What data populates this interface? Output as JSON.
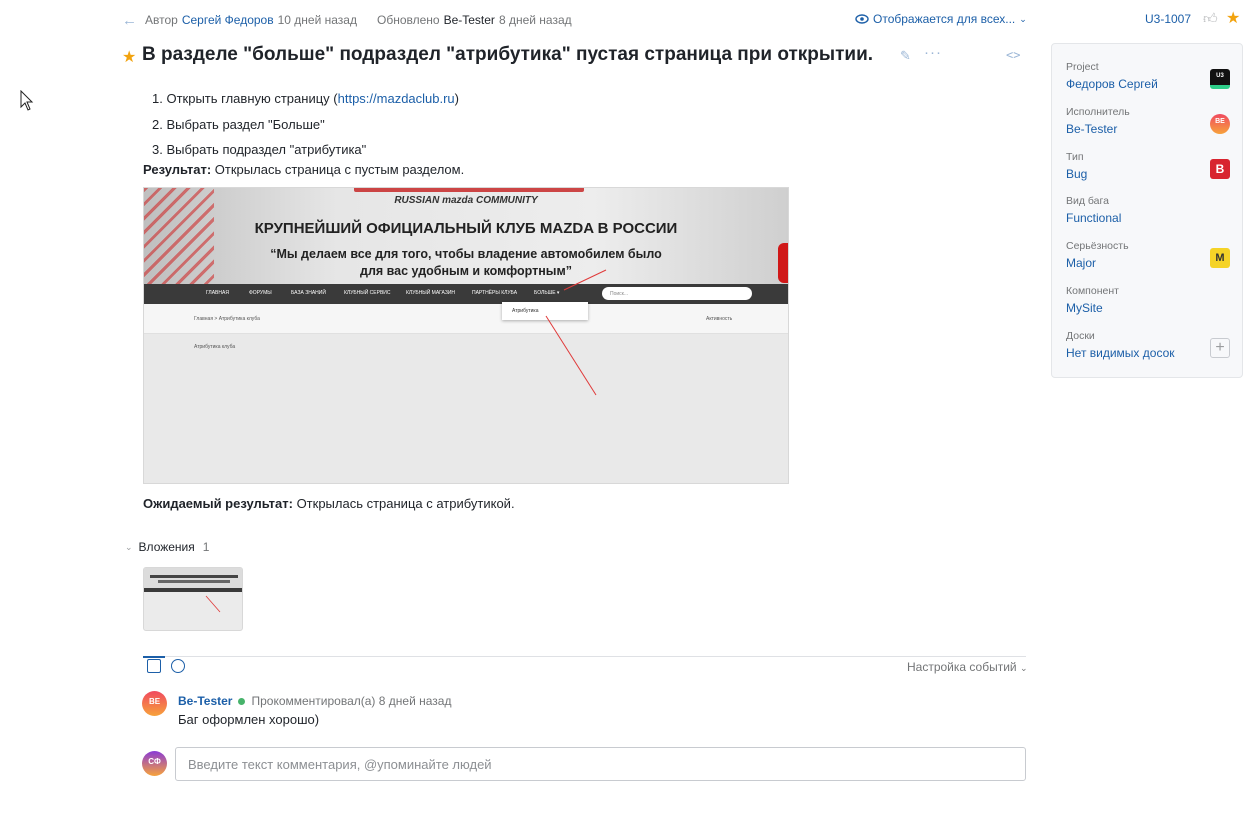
{
  "meta": {
    "author_prefix": "Автор",
    "author": "Сергей Федоров",
    "created": "10 дней назад",
    "updated_prefix": "Обновлено",
    "updater": "Be-Tester",
    "updated": "8 дней назад",
    "visibility": "Отображается для всех...",
    "issue_id": "U3-1007"
  },
  "issue": {
    "title": "В разделе \"больше\" подраздел \"атрибутика\" пустая страница при открытии.",
    "steps": [
      {
        "pre": "Открыть главную страницу (",
        "link": "https://mazdaclub.ru",
        "post": ")"
      },
      {
        "text": "Выбрать раздел \"Больше\""
      },
      {
        "text": "Выбрать подраздел \"атрибутика\""
      }
    ],
    "result_label": "Результат:",
    "result_text": " Открылась страница с пустым разделом.",
    "expected_label": "Ожидаемый результат:",
    "expected_text": " Открылась страница с атрибутикой."
  },
  "screenshot": {
    "brand": "RUSSIAN mazda COMMUNITY",
    "headline": "КРУПНЕЙШИЙ ОФИЦИАЛЬНЫЙ КЛУБ MAZDA В РОССИИ",
    "quote_line1": "“Мы делаем все для того, чтобы владение автомобилем было",
    "quote_line2": "для вас удобным и комфортным”",
    "nav": [
      "ГЛАВНАЯ",
      "ФОРУМЫ",
      "БАЗА ЗНАНИЙ",
      "КЛУБНЫЙ СЕРВИС",
      "КЛУБНЫЙ МАГАЗИН",
      "ПАРТНЁРЫ КЛУБА",
      "БОЛЬШЕ ▾"
    ],
    "search_placeholder": "Поиск...",
    "breadcrumb": "Главная  >  Атрибутика клуба",
    "activity": "Активность",
    "dropdown_item": "Атрибутика",
    "page_heading": "Атрибутика клуба"
  },
  "attachments": {
    "label": "Вложения",
    "count": "1"
  },
  "activity": {
    "events_settings": "Настройка событий"
  },
  "comment": {
    "avatar": "BE",
    "author": "Be-Tester",
    "meta": "Прокомментировал(а) 8 дней назад",
    "text": "Баг оформлен хорошо)"
  },
  "composer": {
    "avatar": "СФ",
    "placeholder": "Введите текст комментария, @упоминайте людей"
  },
  "sidebar": {
    "fields": [
      {
        "label": "Project",
        "value": "Федоров Сергей",
        "badge": "U3"
      },
      {
        "label": "Исполнитель",
        "value": "Be-Tester",
        "badge": "BE"
      },
      {
        "label": "Тип",
        "value": "Bug",
        "badge": "B"
      },
      {
        "label": "Вид бага",
        "value": "Functional",
        "badge": ""
      },
      {
        "label": "Серьёзность",
        "value": "Major",
        "badge": "M"
      },
      {
        "label": "Компонент",
        "value": "MySite",
        "badge": ""
      },
      {
        "label": "Доски",
        "value": "Нет видимых досок",
        "badge": "+"
      }
    ]
  },
  "colors": {
    "link": "#1c5fa8",
    "star": "#f2a30f",
    "bug": "#d8242f",
    "major": "#f5d327",
    "online": "#47b36b"
  },
  "icons": [
    "back-arrow-icon",
    "eye-icon",
    "thumb-up-icon",
    "star-icon",
    "pencil-icon",
    "more-icon",
    "code-icon",
    "chevron-down-icon",
    "comment-tab-icon",
    "history-tab-icon",
    "plus-icon"
  ]
}
